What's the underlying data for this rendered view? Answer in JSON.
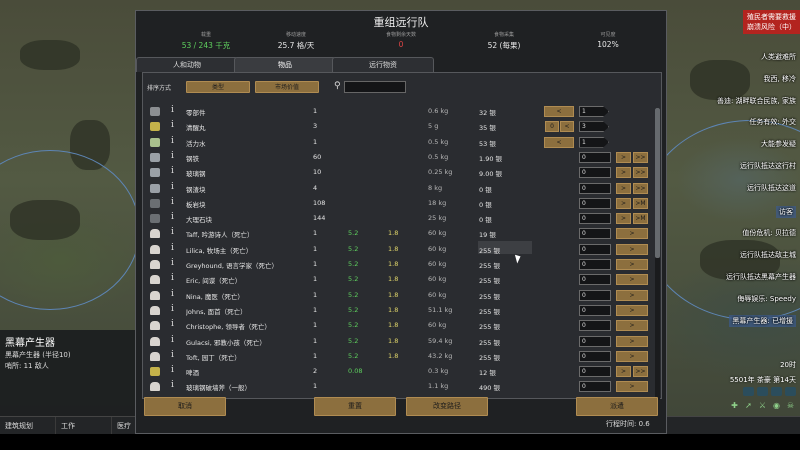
{
  "dialog": {
    "title": "重组远行队",
    "stats": [
      {
        "label": "载重",
        "value": "53 / 243 千克",
        "color": "green"
      },
      {
        "label": "移动速度",
        "value": "25.7 格/天",
        "color": "normal"
      },
      {
        "label": "食物剩余天数",
        "value": "0",
        "color": "red"
      },
      {
        "label": "食物采集",
        "value": "52 (每果)",
        "color": "normal"
      },
      {
        "label": "可见度",
        "value": "102%",
        "color": "normal"
      }
    ],
    "tabs": [
      "人和动物",
      "物品",
      "远行物资"
    ],
    "active_tab": 1,
    "sort_label": "排序方式",
    "sort_buttons": [
      "类型",
      "市场价值"
    ],
    "search_placeholder": "",
    "rows": [
      {
        "icon": "part",
        "name": "零部件",
        "count": "1",
        "speed": "",
        "hp": "",
        "mass": "0.6 kg",
        "value": "32 银",
        "left": [
          "<"
        ],
        "qty": "1",
        "qty_arrow": true,
        "right": []
      },
      {
        "icon": "food",
        "name": "清醒丸",
        "count": "3",
        "speed": "",
        "hp": "",
        "mass": "5 g",
        "value": "35 银",
        "left": [
          "0",
          "<"
        ],
        "qty": "3",
        "qty_arrow": true,
        "right": []
      },
      {
        "icon": "med",
        "name": "活力水",
        "count": "1",
        "speed": "",
        "hp": "",
        "mass": "0.5 kg",
        "value": "53 银",
        "left": [
          "<"
        ],
        "qty": "1",
        "qty_arrow": true,
        "right": []
      },
      {
        "icon": "metal",
        "name": "钢铁",
        "count": "60",
        "speed": "",
        "hp": "",
        "mass": "0.5 kg",
        "value": "1.90 银",
        "left": [],
        "qty": "0",
        "qty_arrow": false,
        "right": [
          ">",
          ">>"
        ]
      },
      {
        "icon": "metal",
        "name": "玻璃钢",
        "count": "10",
        "speed": "",
        "hp": "",
        "mass": "0.25 kg",
        "value": "9.00 银",
        "left": [],
        "qty": "0",
        "qty_arrow": false,
        "right": [
          ">",
          ">>"
        ]
      },
      {
        "icon": "metal",
        "name": "钢渣块",
        "count": "4",
        "speed": "",
        "hp": "",
        "mass": "8 kg",
        "value": "0 银",
        "left": [],
        "qty": "0",
        "qty_arrow": false,
        "right": [
          ">",
          ">>"
        ]
      },
      {
        "icon": "stone",
        "name": "板岩块",
        "count": "108",
        "speed": "",
        "hp": "",
        "mass": "18 kg",
        "value": "0 银",
        "left": [],
        "qty": "0",
        "qty_arrow": false,
        "right": [
          ">",
          ">M"
        ]
      },
      {
        "icon": "stone",
        "name": "大理石块",
        "count": "144",
        "speed": "",
        "hp": "",
        "mass": "25 kg",
        "value": "0 银",
        "left": [],
        "qty": "0",
        "qty_arrow": false,
        "right": [
          ">",
          ">M"
        ]
      },
      {
        "icon": "pawn",
        "name": "Taff, 吟游诗人（死亡）",
        "count": "1",
        "speed": "5.2",
        "hp": "1.8",
        "mass": "60 kg",
        "value": "19 银",
        "left": [],
        "qty": "0",
        "qty_arrow": false,
        "right": [
          ">"
        ]
      },
      {
        "icon": "pawn",
        "name": "Lilica, 牧场主（死亡）",
        "count": "1",
        "speed": "5.2",
        "hp": "1.8",
        "mass": "60 kg",
        "value": "255 银",
        "left": [],
        "qty": "0",
        "qty_arrow": false,
        "right": [
          ">"
        ]
      },
      {
        "icon": "pawn",
        "name": "Greyhound, 语言学家（死亡）",
        "count": "1",
        "speed": "5.2",
        "hp": "1.8",
        "mass": "60 kg",
        "value": "255 银",
        "left": [],
        "qty": "0",
        "qty_arrow": false,
        "right": [
          ">"
        ]
      },
      {
        "icon": "pawn",
        "name": "Eric, 间谍（死亡）",
        "count": "1",
        "speed": "5.2",
        "hp": "1.8",
        "mass": "60 kg",
        "value": "255 银",
        "left": [],
        "qty": "0",
        "qty_arrow": false,
        "right": [
          ">"
        ]
      },
      {
        "icon": "pawn",
        "name": "Nina, 魔医（死亡）",
        "count": "1",
        "speed": "5.2",
        "hp": "1.8",
        "mass": "60 kg",
        "value": "255 银",
        "left": [],
        "qty": "0",
        "qty_arrow": false,
        "right": [
          ">"
        ]
      },
      {
        "icon": "pawn",
        "name": "Johns, 面首（死亡）",
        "count": "1",
        "speed": "5.2",
        "hp": "1.8",
        "mass": "51.1 kg",
        "value": "255 银",
        "left": [],
        "qty": "0",
        "qty_arrow": false,
        "right": [
          ">"
        ]
      },
      {
        "icon": "pawn",
        "name": "Christophe, 领导者（死亡）",
        "count": "1",
        "speed": "5.2",
        "hp": "1.8",
        "mass": "60 kg",
        "value": "255 银",
        "left": [],
        "qty": "0",
        "qty_arrow": false,
        "right": [
          ">"
        ]
      },
      {
        "icon": "pawn",
        "name": "Gulacsi, 邪教小孩（死亡）",
        "count": "1",
        "speed": "5.2",
        "hp": "1.8",
        "mass": "59.4 kg",
        "value": "255 银",
        "left": [],
        "qty": "0",
        "qty_arrow": false,
        "right": [
          ">"
        ]
      },
      {
        "icon": "pawn",
        "name": "Toft, 园丁（死亡）",
        "count": "1",
        "speed": "5.2",
        "hp": "1.8",
        "mass": "43.2 kg",
        "value": "255 银",
        "left": [],
        "qty": "0",
        "qty_arrow": false,
        "right": [
          ">"
        ]
      },
      {
        "icon": "food",
        "name": "啤酒",
        "count": "2",
        "speed": "0.08",
        "hp": "",
        "mass": "0.3 kg",
        "value": "12 银",
        "left": [],
        "qty": "0",
        "qty_arrow": false,
        "right": [
          ">",
          ">>"
        ]
      },
      {
        "icon": "pawn",
        "name": "玻璃钢破墙斧（一般）",
        "count": "1",
        "speed": "",
        "hp": "",
        "mass": "1.1 kg",
        "value": "490 银",
        "left": [],
        "qty": "0",
        "qty_arrow": false,
        "right": [
          ">"
        ]
      }
    ],
    "buttons": {
      "cancel": "取消",
      "reset": "重置",
      "route": "改变路径",
      "send": "派遣"
    },
    "trip_time": "行程时间:  0.6"
  },
  "left_info": {
    "title": "黑幕产生器",
    "line1": "黑幕产生器 (半径10)",
    "line2": "哨所: 11 敌人"
  },
  "bottom_bar": [
    "建筑规划",
    "工作",
    "医疗"
  ],
  "right_panel": {
    "alert": [
      "殖民者需要救援",
      "崩溃风险（中）"
    ],
    "labels": [
      "人类避难所",
      "我西, 移冷",
      "善迪: 湖畔联合民族, 家族",
      "任务有效: 外交",
      "大能参发疑",
      "远行队抵达这行村",
      "远行队抵达这道",
      "访客",
      "值份危机: 贝拉德",
      "远行队抵达敌主城",
      "远行队抵达黑幕产生器",
      "侮辱娱乐: Speedy",
      "黑幕产生器: 已增援"
    ],
    "hour": "20时",
    "date": "5501年 茶豪 第14天",
    "last_fragment": "索"
  },
  "colors": {
    "accent_button": "#8c6f3e",
    "green": "#5ed05e",
    "red": "#e04545",
    "alert_bg": "#b3241f"
  }
}
